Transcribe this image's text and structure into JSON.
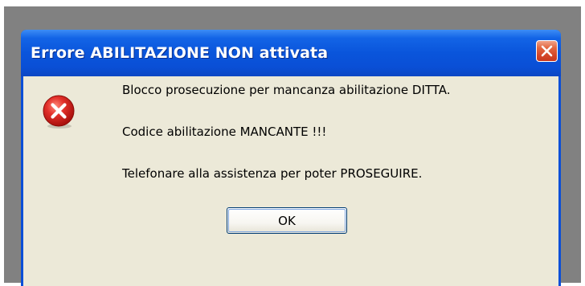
{
  "dialog": {
    "title": "Errore ABILITAZIONE NON attivata",
    "icon": "error-icon",
    "close_icon": "close-icon",
    "messages": [
      "Blocco prosecuzione per mancanza abilitazione DITTA.",
      "Codice abilitazione MANCANTE !!!",
      "Telefonare alla assistenza per poter PROSEGUIRE."
    ],
    "ok_label": "OK"
  },
  "colors": {
    "titlebar": "#0a55db",
    "client_bg": "#ece9d8",
    "close_button": "#d4472a",
    "error_icon": "#d61f1f",
    "desktop": "#818181"
  }
}
